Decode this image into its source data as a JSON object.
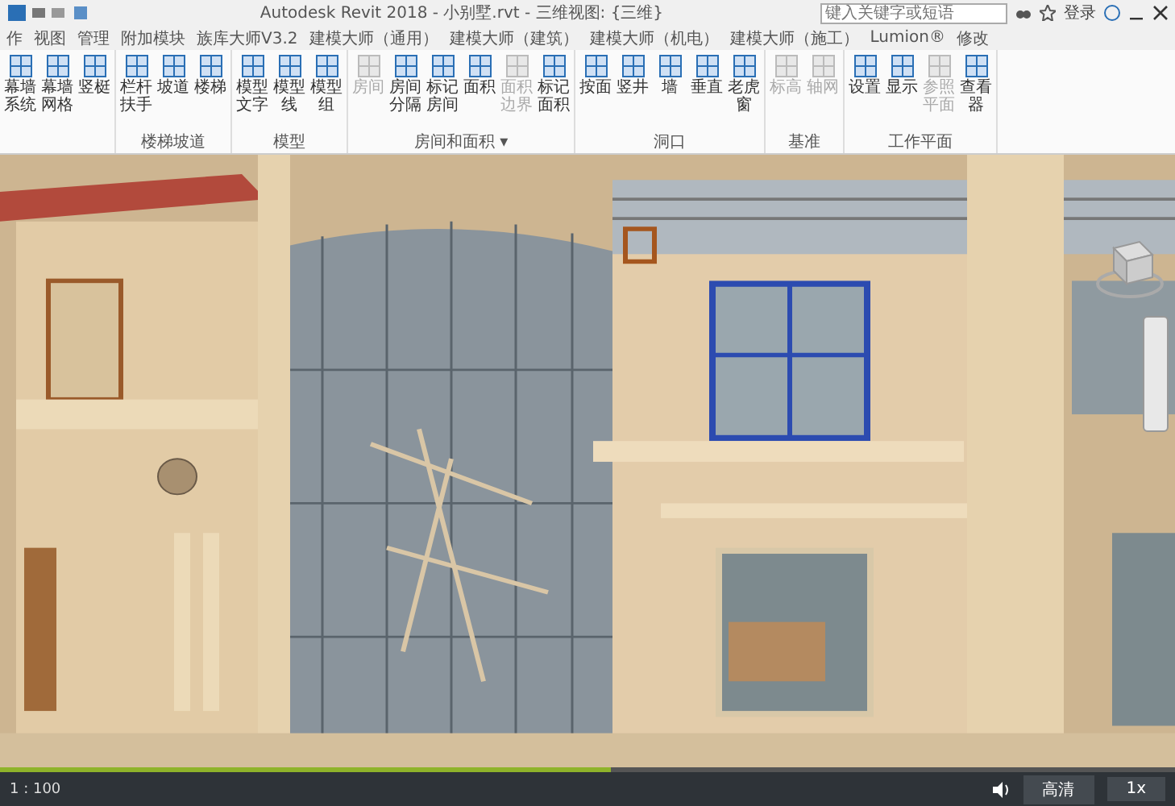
{
  "window": {
    "title": "Autodesk Revit 2018 -    小别墅.rvt - 三维视图: {三维}"
  },
  "search": {
    "placeholder": "键入关键字或短语"
  },
  "account": {
    "label": "登录"
  },
  "tabs": [
    {
      "label": "作",
      "selected": false
    },
    {
      "label": "视图",
      "selected": false
    },
    {
      "label": "管理",
      "selected": false
    },
    {
      "label": "附加模块",
      "selected": false
    },
    {
      "label": "族库大师V3.2",
      "selected": false
    },
    {
      "label": "建模大师（通用）",
      "selected": false
    },
    {
      "label": "建模大师（建筑）",
      "selected": false
    },
    {
      "label": "建模大师（机电）",
      "selected": false
    },
    {
      "label": "建模大师（施工）",
      "selected": false
    },
    {
      "label": "Lumion®",
      "selected": false
    },
    {
      "label": "修改",
      "selected": false
    }
  ],
  "panels": [
    {
      "buttons": [
        {
          "label": "幕墙系统",
          "disabled": false
        },
        {
          "label": "幕墙网格",
          "disabled": false
        },
        {
          "label": "竖梃",
          "disabled": false
        }
      ]
    },
    {
      "label": "楼梯坡道",
      "buttons": [
        {
          "label": "栏杆扶手",
          "disabled": false
        },
        {
          "label": "坡道",
          "disabled": false
        },
        {
          "label": "楼梯",
          "disabled": false
        }
      ]
    },
    {
      "label": "模型",
      "buttons": [
        {
          "label": "模型文字",
          "disabled": false
        },
        {
          "label": "模型线",
          "disabled": false
        },
        {
          "label": "模型组",
          "disabled": false
        }
      ]
    },
    {
      "label": "房间和面积 ▾",
      "buttons": [
        {
          "label": "房间",
          "disabled": true
        },
        {
          "label": "房间分隔",
          "disabled": false
        },
        {
          "label": "标记房间",
          "disabled": false
        },
        {
          "label": "面积",
          "disabled": false
        },
        {
          "label": "面积边界",
          "disabled": true
        },
        {
          "label": "标记面积",
          "disabled": false
        }
      ]
    },
    {
      "label": "洞口",
      "buttons": [
        {
          "label": "按面",
          "disabled": false
        },
        {
          "label": "竖井",
          "disabled": false
        },
        {
          "label": "墙",
          "disabled": false
        },
        {
          "label": "垂直",
          "disabled": false
        },
        {
          "label": "老虎窗",
          "disabled": false
        }
      ]
    },
    {
      "label": "基准",
      "buttons": [
        {
          "label": "标高",
          "disabled": true
        },
        {
          "label": "轴网",
          "disabled": true
        }
      ]
    },
    {
      "label": "工作平面",
      "buttons": [
        {
          "label": "设置",
          "disabled": false
        },
        {
          "label": "显示",
          "disabled": false
        },
        {
          "label": "参照平面",
          "disabled": true
        },
        {
          "label": "查看器",
          "disabled": false
        }
      ]
    }
  ],
  "view_bar": {
    "scale": "1 : 100"
  },
  "player": {
    "level": 0.52,
    "quality": "高清",
    "speed": "1x"
  }
}
